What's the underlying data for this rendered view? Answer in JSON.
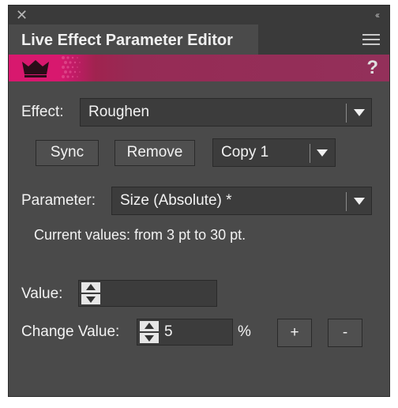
{
  "window": {
    "close_glyph": "✕",
    "collapse_glyph": "‹‹",
    "title": "Live Effect Parameter Editor",
    "help_glyph": "?"
  },
  "effect": {
    "label": "Effect:",
    "selected": "Roughen"
  },
  "actions": {
    "sync_label": "Sync",
    "remove_label": "Remove",
    "copy_selected": "Copy 1"
  },
  "parameter": {
    "label": "Parameter:",
    "selected": "Size (Absolute) *",
    "current_values": "Current values: from 3 pt to 30 pt."
  },
  "value": {
    "label": "Value:",
    "input": ""
  },
  "change": {
    "label": "Change Value:",
    "input": "5",
    "unit": "%",
    "plus_label": "+",
    "minus_label": "-"
  },
  "colors": {
    "accent": "#d8186e",
    "banner": "#93305a",
    "panel": "#4a4a4a"
  }
}
